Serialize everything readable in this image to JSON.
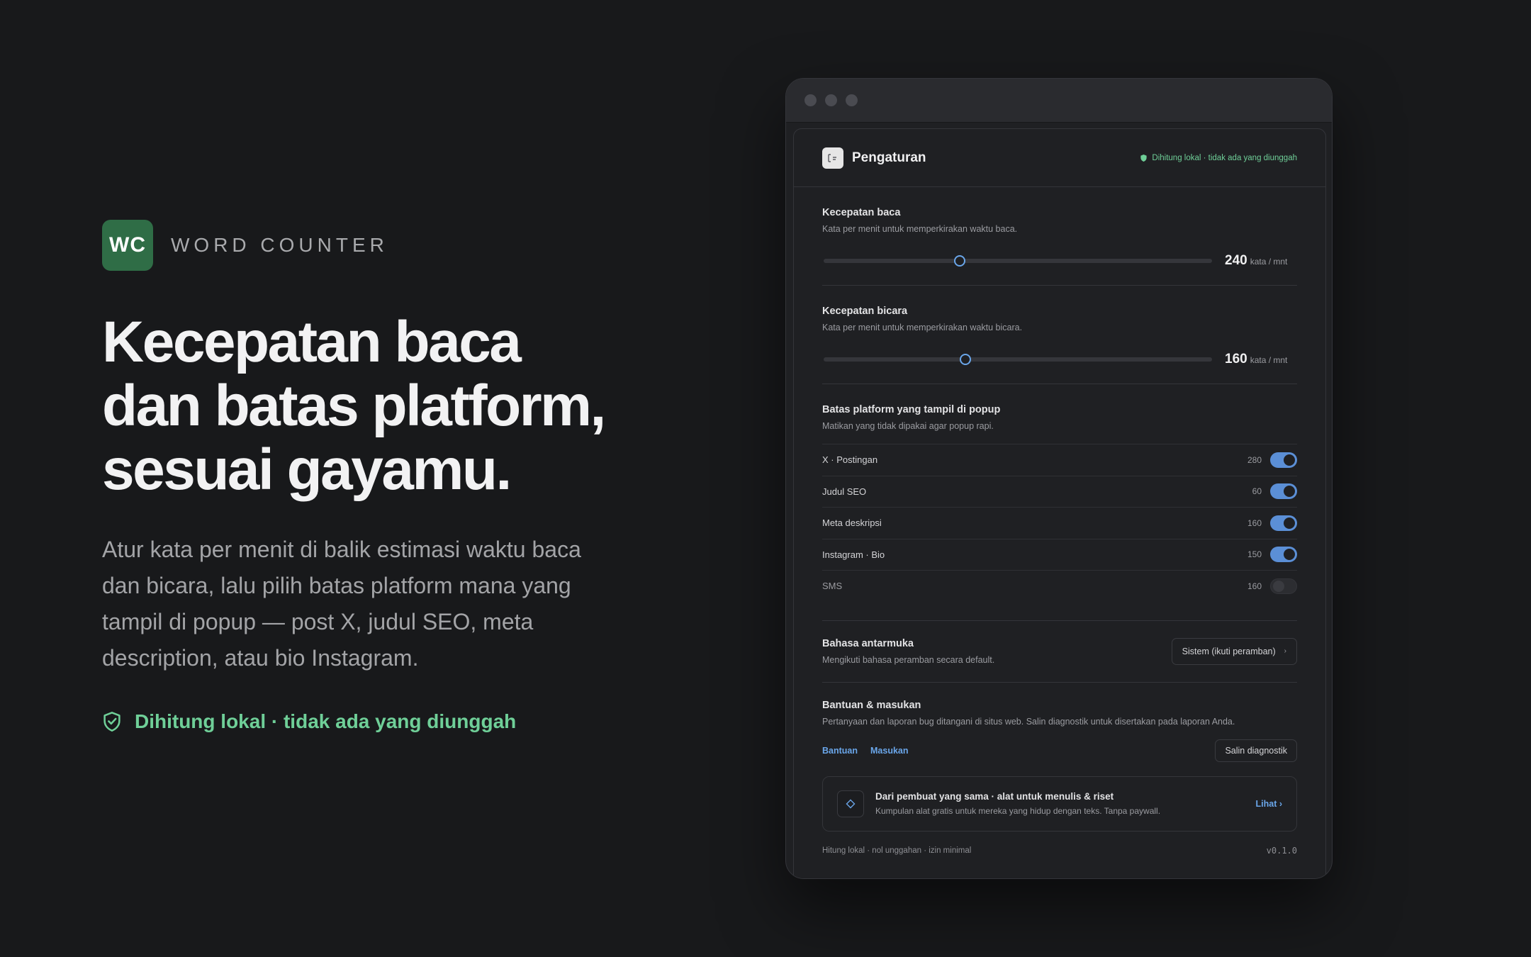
{
  "brand": {
    "logo_text": "WC",
    "name": "WORD COUNTER"
  },
  "hero": {
    "title_lines": [
      "Kecepatan baca",
      "dan batas platform,",
      "sesuai gayamu."
    ],
    "desc_lines": [
      "Atur kata per menit di balik estimasi waktu baca",
      "dan bicara, lalu pilih batas platform mana yang",
      "tampil di popup — post X, judul SEO, meta",
      "description, atau bio Instagram."
    ],
    "badge": "Dihitung lokal · tidak ada yang diunggah",
    "badge_icon": "shield-check-icon"
  },
  "colors": {
    "accent": "#6aa6ea",
    "brand": "#2f6d46",
    "success": "#6fcf98",
    "background": "#18191b"
  },
  "settings": {
    "title": "Pengaturan",
    "status": "Dihitung lokal · tidak ada yang diunggah",
    "reading": {
      "title": "Kecepatan baca",
      "subtitle": "Kata per menit untuk memperkirakan waktu baca.",
      "value": "240",
      "unit": "kata / mnt",
      "slider_fraction": 0.35
    },
    "speaking": {
      "title": "Kecepatan bicara",
      "subtitle": "Kata per menit untuk memperkirakan waktu bicara.",
      "value": "160",
      "unit": "kata / mnt",
      "slider_fraction": 0.365
    },
    "platforms": {
      "title": "Batas platform yang tampil di popup",
      "subtitle": "Matikan yang tidak dipakai agar popup rapi.",
      "items": [
        {
          "label": "X · Postingan",
          "limit": "280",
          "enabled": true
        },
        {
          "label": "Judul SEO",
          "limit": "60",
          "enabled": true
        },
        {
          "label": "Meta deskripsi",
          "limit": "160",
          "enabled": true
        },
        {
          "label": "Instagram · Bio",
          "limit": "150",
          "enabled": true
        },
        {
          "label": "SMS",
          "limit": "160",
          "enabled": false
        }
      ]
    },
    "language": {
      "title": "Bahasa antarmuka",
      "subtitle": "Mengikuti bahasa peramban secara default.",
      "selected": "Sistem (ikuti peramban)"
    },
    "help": {
      "title": "Bantuan & masukan",
      "subtitle": "Pertanyaan dan laporan bug ditangani di situs web. Salin diagnostik untuk disertakan pada laporan Anda.",
      "help_link": "Bantuan",
      "feedback_link": "Masukan",
      "copy_button": "Salin diagnostik"
    },
    "promo": {
      "title": "Dari pembuat yang sama · alat untuk menulis & riset",
      "subtitle": "Kumpulan alat gratis untuk mereka yang hidup dengan teks. Tanpa paywall.",
      "link": "Lihat ›"
    },
    "footer": {
      "note": "Hitung lokal · nol unggahan · izin minimal",
      "version": "v0.1.0"
    }
  }
}
